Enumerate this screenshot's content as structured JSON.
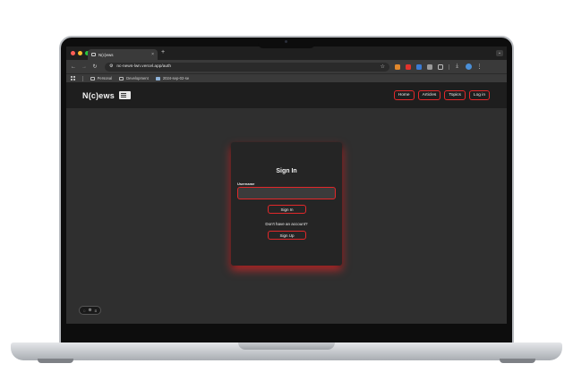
{
  "browser": {
    "tab_title": "N(c)ews",
    "tab_close": "×",
    "new_tab": "+",
    "url": "nc-news-lwn.vercel.app/auth",
    "bookmarks": [
      "Personal",
      "Development",
      "2024-sep-02-se"
    ]
  },
  "site": {
    "logo": "N(c)ews",
    "nav": [
      "Home",
      "Articles",
      "Topics",
      "Log in"
    ]
  },
  "auth_card": {
    "title": "Sign In",
    "username_label": "Username",
    "username_value": "",
    "sign_in_label": "Sign In",
    "no_account_text": "Don't have an account?",
    "sign_up_label": "Sign Up"
  },
  "colors": {
    "accent": "#e2282a",
    "page_bg": "#2f2f2f",
    "card_bg": "#252525",
    "header_bg": "#1e1e1e"
  }
}
